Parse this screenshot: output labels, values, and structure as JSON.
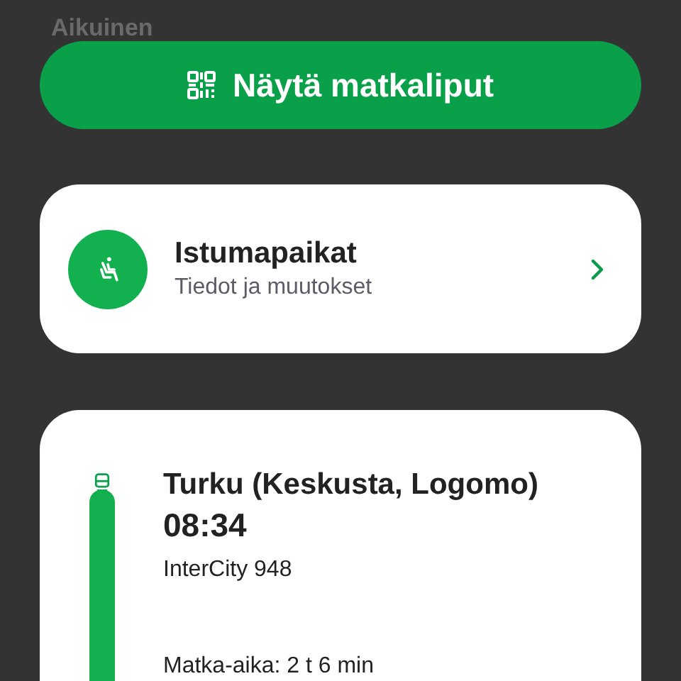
{
  "passenger_label": "Aikuinen",
  "show_tickets_button": {
    "label": "Näytä matkaliput"
  },
  "seats_card": {
    "title": "Istumapaikat",
    "subtitle": "Tiedot ja muutokset"
  },
  "journey": {
    "station": "Turku (Keskusta, Logomo)",
    "time": "08:34",
    "train": "InterCity 948",
    "duration": "Matka-aika: 2 t 6 min"
  }
}
